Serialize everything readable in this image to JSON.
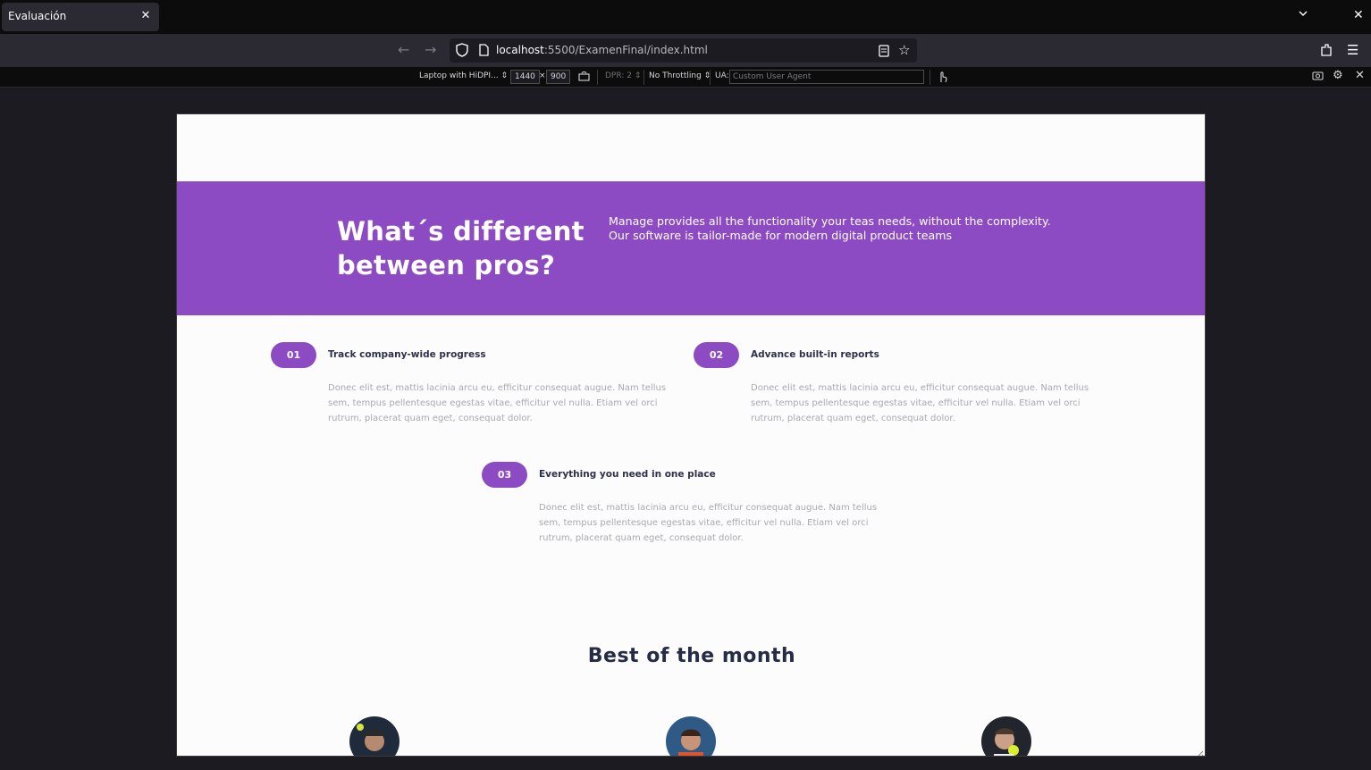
{
  "browser": {
    "tab_title": "Evaluación",
    "url_host": "localhost",
    "url_path": ":5500/ExamenFinal/index.html"
  },
  "rdm": {
    "device": "Laptop with HiDPI...",
    "width": "1440",
    "times": "×",
    "height": "900",
    "dpr": "DPR: 2",
    "throttling": "No Throttling",
    "ua_label": "UA:",
    "ua_placeholder": "Custom User Agent"
  },
  "hero": {
    "title": "What´s different between pros?",
    "text": "Manage provides all the functionality your teas needs, without the complexity. Our software is tailor-made for modern digital product teams"
  },
  "features": [
    {
      "number": "01",
      "title": "Track company-wide progress",
      "body": "Donec elit est, mattis lacinia arcu eu, efficitur consequat augue. Nam tellus sem, tempus pellentesque egestas vitae, efficitur vel nulla. Etiam vel orci rutrum, placerat quam eget, consequat dolor."
    },
    {
      "number": "02",
      "title": "Advance built-in reports",
      "body": "Donec elit est, mattis lacinia arcu eu, efficitur consequat augue. Nam tellus sem, tempus pellentesque egestas vitae, efficitur vel nulla. Etiam vel orci rutrum, placerat quam eget, consequat dolor."
    },
    {
      "number": "03",
      "title": "Everything you need in one place",
      "body": "Donec elit est, mattis lacinia arcu eu, efficitur consequat augue. Nam tellus sem, tempus pellentesque egestas vitae, efficitur vel nulla. Etiam vel orci rutrum, placerat quam eget, consequat dolor."
    }
  ],
  "best": {
    "title": "Best of the month"
  },
  "colors": {
    "accent": "#8c4bc2",
    "heading": "#262b46"
  }
}
